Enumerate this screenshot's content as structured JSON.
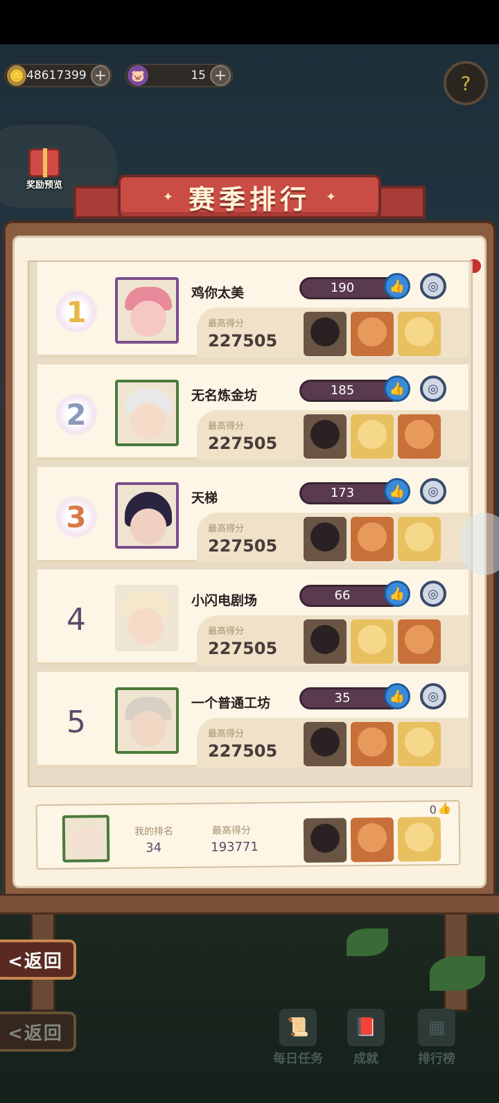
{
  "currency": {
    "coins": "48617399",
    "gems": "15",
    "plus": "+",
    "coin_icon": "🪙",
    "gem_icon": "🐷"
  },
  "help_icon": "?",
  "gift": {
    "label": "奖励预览"
  },
  "banner": {
    "title": "赛季排行",
    "star": "✦"
  },
  "score_label": "最高得分",
  "entries": [
    {
      "rank": "1",
      "name": "鸡你太美",
      "likes": "190",
      "score": "227505"
    },
    {
      "rank": "2",
      "name": "无名炼金坊",
      "likes": "185",
      "score": "227505"
    },
    {
      "rank": "3",
      "name": "天梯",
      "likes": "173",
      "score": "227505"
    },
    {
      "rank": "4",
      "name": "小闪电剧场",
      "likes": "66",
      "score": "227505"
    },
    {
      "rank": "5",
      "name": "一个普通工坊",
      "likes": "35",
      "score": "227505"
    }
  ],
  "my": {
    "rank_label": "我的排名",
    "rank": "34",
    "score_label": "最高得分",
    "score": "193771",
    "likes": "0"
  },
  "back": {
    "label": "<返回"
  },
  "nav": [
    {
      "label": "每日任务",
      "icon": "📜"
    },
    {
      "label": "成就",
      "icon": "📕"
    },
    {
      "label": "排行榜",
      "icon": "▦"
    }
  ],
  "colors": {
    "banner": "#c94c45",
    "board": "#8a5c40",
    "panel": "#fbf1df",
    "like_button": "#3a8ad8"
  }
}
